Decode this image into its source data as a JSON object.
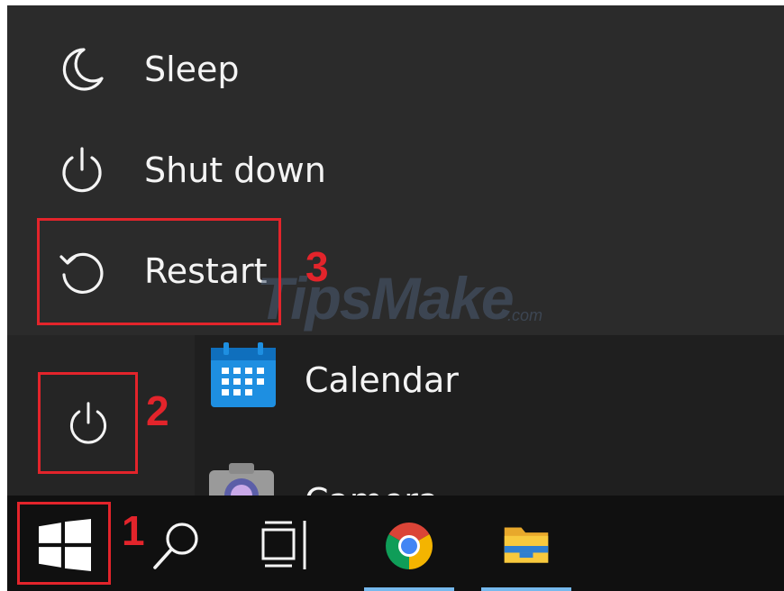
{
  "power_menu": {
    "items": [
      {
        "label": "Sleep",
        "icon": "moon-icon"
      },
      {
        "label": "Shut down",
        "icon": "power-icon"
      },
      {
        "label": "Restart",
        "icon": "restart-icon"
      }
    ]
  },
  "start_menu": {
    "power_button_icon": "power-icon",
    "apps": [
      {
        "label": "Calendar",
        "icon": "calendar-icon"
      },
      {
        "label": "Camera",
        "icon": "camera-icon"
      }
    ]
  },
  "taskbar": {
    "buttons": [
      {
        "icon": "windows-logo-icon"
      },
      {
        "icon": "search-icon"
      },
      {
        "icon": "task-view-icon"
      },
      {
        "icon": "chrome-icon"
      },
      {
        "icon": "file-explorer-icon"
      }
    ]
  },
  "annotations": {
    "step_1": "1",
    "step_2": "2",
    "step_3": "3",
    "color": "#e3242b"
  },
  "watermark": {
    "brand": "TipsMake",
    "suffix": ".com"
  },
  "colors": {
    "menu_bg": "#2b2b2b",
    "start_bg": "#1f1f1f",
    "taskbar_bg": "#101010",
    "text": "#f4f4f4",
    "taskbar_accent": "#76b9ed"
  }
}
